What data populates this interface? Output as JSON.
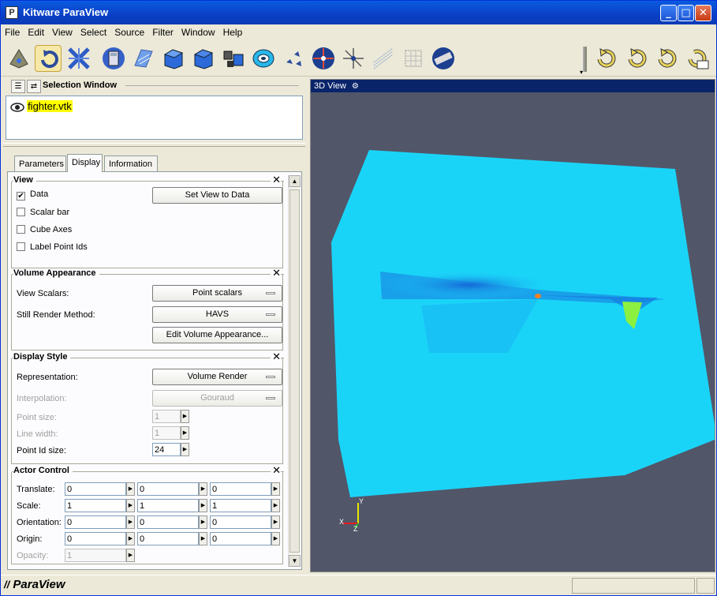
{
  "window": {
    "title": "Kitware ParaView"
  },
  "menu": [
    "File",
    "Edit",
    "View",
    "Select",
    "Source",
    "Filter",
    "Window",
    "Help"
  ],
  "toolbar": {
    "tools": [
      "reset-camera-icon",
      "rotate-icon",
      "pan-zoom-icon",
      "calculator-icon",
      "contour-icon",
      "clip-icon",
      "cut-icon",
      "threshold-icon",
      "glyph-icon",
      "stream-icon",
      "center-icon",
      "pick-center-icon",
      "line-probe-icon",
      "volume-icon",
      "ruler-icon"
    ],
    "history": [
      "undo-icon",
      "redo-icon",
      "undo-camera-icon",
      "redo-camera-icon"
    ]
  },
  "selection": {
    "title": "Selection Window",
    "items": [
      {
        "name": "fighter.vtk",
        "visible": true
      }
    ]
  },
  "tabs": [
    "Parameters",
    "Display",
    "Information"
  ],
  "active_tab": "Display",
  "view_group": {
    "title": "View",
    "data_label": "Data",
    "data_checked": true,
    "scalar_bar": "Scalar bar",
    "cube_axes": "Cube Axes",
    "label_point_ids": "Label Point Ids",
    "set_view_button": "Set View to Data"
  },
  "volume_group": {
    "title": "Volume Appearance",
    "view_scalars_label": "View Scalars:",
    "view_scalars_value": "Point scalars",
    "still_render_label": "Still Render Method:",
    "still_render_value": "HAVS",
    "edit_button": "Edit Volume Appearance..."
  },
  "style_group": {
    "title": "Display Style",
    "representation_label": "Representation:",
    "representation_value": "Volume Render",
    "interpolation_label": "Interpolation:",
    "interpolation_value": "Gouraud",
    "point_size_label": "Point size:",
    "point_size": "1",
    "line_width_label": "Line width:",
    "line_width": "1",
    "point_id_size_label": "Point Id size:",
    "point_id_size": "24"
  },
  "actor_group": {
    "title": "Actor Control",
    "translate_label": "Translate:",
    "translate": [
      "0",
      "0",
      "0"
    ],
    "scale_label": "Scale:",
    "scale": [
      "1",
      "1",
      "1"
    ],
    "orientation_label": "Orientation:",
    "orientation": [
      "0",
      "0",
      "0"
    ],
    "origin_label": "Origin:",
    "origin": [
      "0",
      "0",
      "0"
    ],
    "opacity_label": "Opacity:",
    "opacity": "1"
  },
  "view3d": {
    "title": "3D View",
    "background": "#525669",
    "volume_color": "#1ad4f8",
    "axes": {
      "x": "X",
      "y": "Y",
      "z": "Z"
    }
  },
  "status": {
    "logo": "ParaView"
  }
}
